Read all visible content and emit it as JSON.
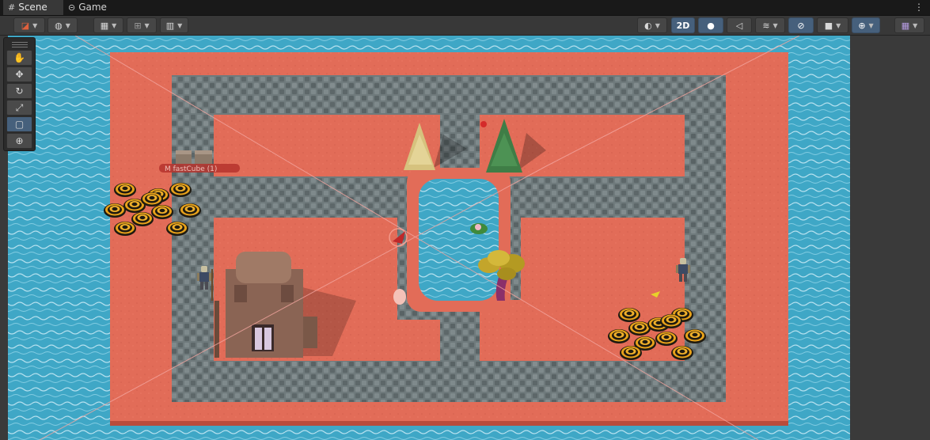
{
  "tabs": [
    {
      "label": "Scene",
      "icon": "grid-icon"
    },
    {
      "label": "Game",
      "icon": "gamepad-icon"
    }
  ],
  "tab_menu_icon": "kebab-menu-icon",
  "toolbar": {
    "draw_mode_icon": "shading-mode-icon",
    "global_icon": "globe-icon",
    "grid_snap_icon": "grid-snap-icon",
    "increment_snap_icon": "increment-snap-icon",
    "ruler_icon": "ruler-icon",
    "render_mode_icon": "render-sphere-icon",
    "two_d_label": "2D",
    "lighting_icon": "lightbulb-icon",
    "audio_icon": "audio-muted-icon",
    "effects_icon": "effects-layers-icon",
    "visibility_icon": "hidden-eye-icon",
    "camera_icon": "camera-icon",
    "gizmos_icon": "gizmos-icon",
    "layers_icon": "layers-grid-icon"
  },
  "tools": [
    {
      "name": "hand-tool",
      "glyph": "✋"
    },
    {
      "name": "move-tool",
      "glyph": "✥"
    },
    {
      "name": "rotate-tool",
      "glyph": "↻"
    },
    {
      "name": "scale-tool",
      "glyph": "⤢"
    },
    {
      "name": "rect-tool",
      "glyph": "▢",
      "active": true
    },
    {
      "name": "transform-tool",
      "glyph": "⊕"
    }
  ],
  "scene": {
    "selected_object_label": "M  fastCube (1)",
    "colors": {
      "water": "#3fa7c6",
      "floor": "#e26c58",
      "stone": "#6f7a7c",
      "background": "#3a3a3a"
    }
  }
}
